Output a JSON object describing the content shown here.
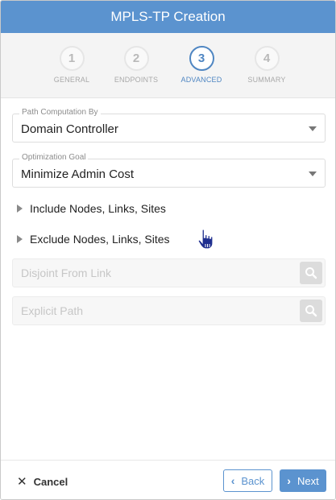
{
  "dialog": {
    "title": "MPLS-TP Creation"
  },
  "stepper": {
    "steps": [
      {
        "number": "1",
        "label": "GENERAL",
        "state": "inactive"
      },
      {
        "number": "2",
        "label": "ENDPOINTS",
        "state": "inactive"
      },
      {
        "number": "3",
        "label": "ADVANCED",
        "state": "active"
      },
      {
        "number": "4",
        "label": "SUMMARY",
        "state": "inactive"
      }
    ]
  },
  "form": {
    "path_computation": {
      "label": "Path Computation By",
      "value": "Domain Controller"
    },
    "optimization_goal": {
      "label": "Optimization Goal",
      "value": "Minimize Admin Cost"
    },
    "include_section": {
      "label": "Include Nodes, Links, Sites",
      "expanded": false
    },
    "exclude_section": {
      "label": "Exclude Nodes, Links, Sites",
      "expanded": false
    },
    "disjoint_from_link": {
      "placeholder": "Disjoint From Link",
      "value": ""
    },
    "explicit_path": {
      "placeholder": "Explicit Path",
      "value": ""
    }
  },
  "footer": {
    "cancel_label": "Cancel",
    "back_label": "Back",
    "next_label": "Next"
  },
  "icons": {
    "cancel": "close-icon",
    "back": "chevron-left-icon",
    "next": "chevron-right-icon",
    "search": "search-icon",
    "expand": "triangle-right-icon",
    "dropdown": "caret-down-icon"
  },
  "colors": {
    "accent": "#5b93cf",
    "active_step": "#4f86c2",
    "title_text": "#ffffff"
  }
}
